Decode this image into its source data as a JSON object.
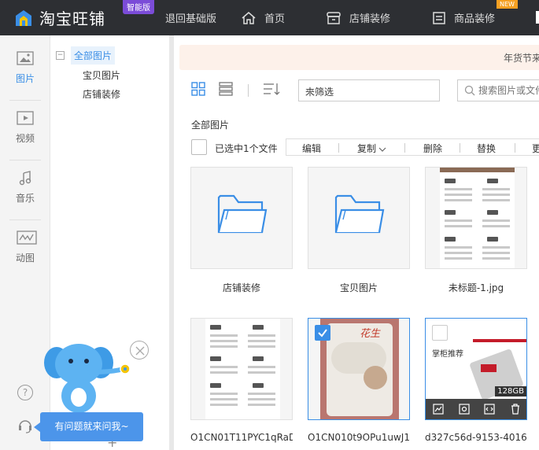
{
  "topbar": {
    "brand": "淘宝旺铺",
    "edition": "智能版",
    "nav": [
      {
        "label": "退回基础版",
        "icon": "none"
      },
      {
        "label": "首页",
        "icon": "home-icon"
      },
      {
        "label": "店铺装修",
        "icon": "shop-icon"
      },
      {
        "label": "商品装修",
        "icon": "goods-icon"
      }
    ],
    "new_badge": "NEW"
  },
  "rail": {
    "items": [
      {
        "label": "图片",
        "icon": "image-icon",
        "active": true
      },
      {
        "label": "视频",
        "icon": "video-icon",
        "active": false
      },
      {
        "label": "音乐",
        "icon": "music-icon",
        "active": false
      },
      {
        "label": "动图",
        "icon": "gif-icon",
        "active": false
      }
    ],
    "help": "?"
  },
  "tree": {
    "root": "全部图片",
    "toggle": "−",
    "children": [
      "宝贝图片",
      "店铺装修"
    ],
    "add": "+"
  },
  "notice": {
    "text": "年货节来"
  },
  "toolbar": {
    "filter_value": "未筛选",
    "search_placeholder": "搜索图片或文件"
  },
  "crumb": "全部图片",
  "selection": {
    "info": "已选中1个文件",
    "actions": [
      "编辑",
      "复制",
      "删除",
      "替换",
      "更"
    ]
  },
  "tiles": [
    {
      "name": "店铺装修",
      "type": "folder",
      "checked": false
    },
    {
      "name": "宝贝图片",
      "type": "folder",
      "checked": false
    },
    {
      "name": "未标题-1.jpg",
      "type": "doc",
      "checked": false
    },
    {
      "name": "O1CN01T11PYC1qRaD",
      "type": "doc",
      "checked": false
    },
    {
      "name": "O1CN010t9OPu1uwJ1",
      "type": "photo",
      "checked": true,
      "photo_text": "花生"
    },
    {
      "name": "d327c56d-9153-4016-",
      "type": "product",
      "checked": false,
      "product_title": "掌柜推荐",
      "capacity": "128GB"
    }
  ],
  "helper": {
    "bubble": "有问题就来问我~",
    "close": "×"
  },
  "colors": {
    "accent": "#3a8ee6",
    "topbar": "#2d2f33",
    "notice_bg": "#fdf1ea",
    "helper": "#4c95ea"
  }
}
